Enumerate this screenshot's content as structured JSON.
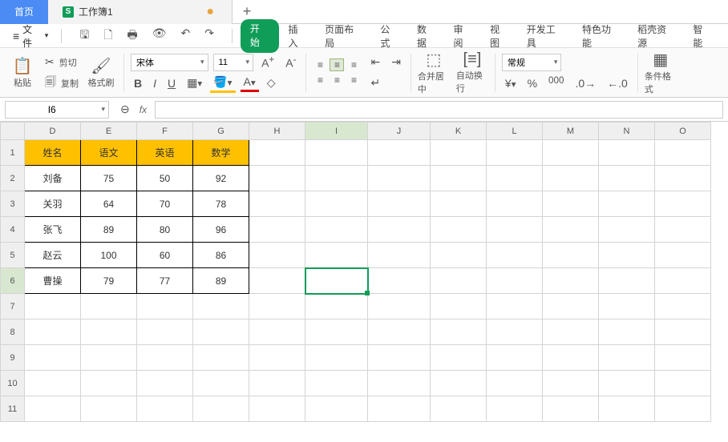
{
  "tabs": {
    "home": "首页",
    "doc": "工作簿1",
    "modified": "●"
  },
  "menu": {
    "file": "文件",
    "items": [
      "开始",
      "插入",
      "页面布局",
      "公式",
      "数据",
      "审阅",
      "视图",
      "开发工具",
      "特色功能",
      "稻壳资源",
      "智能"
    ],
    "active_index": 0
  },
  "ribbon": {
    "paste": "粘贴",
    "cut": "剪切",
    "copy": "复制",
    "format_painter": "格式刷",
    "font_name": "宋体",
    "font_size": "11",
    "merge_center": "合并居中",
    "auto_wrap": "自动换行",
    "number_format": "常规",
    "cond_format": "条件格式"
  },
  "name_box": "I6",
  "fx_label": "fx",
  "columns": [
    "",
    "D",
    "E",
    "F",
    "G",
    "H",
    "I",
    "J",
    "K",
    "L",
    "M",
    "N",
    "O"
  ],
  "rows": [
    "1",
    "2",
    "3",
    "4",
    "5",
    "6",
    "7",
    "8",
    "9",
    "10",
    "11"
  ],
  "header_row": [
    "姓名",
    "语文",
    "英语",
    "数学"
  ],
  "data_rows": [
    [
      "刘备",
      "75",
      "50",
      "92"
    ],
    [
      "关羽",
      "64",
      "70",
      "78"
    ],
    [
      "张飞",
      "89",
      "80",
      "96"
    ],
    [
      "赵云",
      "100",
      "60",
      "86"
    ],
    [
      "曹操",
      "79",
      "77",
      "89"
    ]
  ],
  "selected_col_index": 6,
  "selected_row_index": 5
}
